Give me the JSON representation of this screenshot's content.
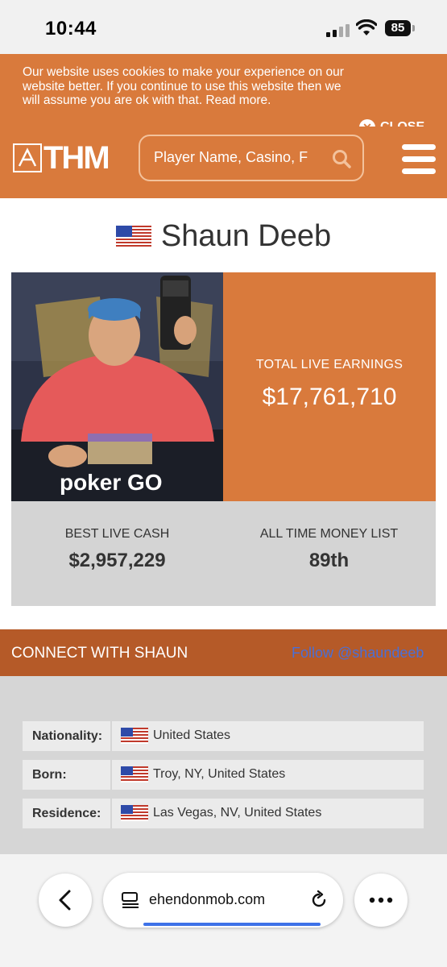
{
  "status_bar": {
    "time": "10:44",
    "battery": "85"
  },
  "cookie_banner": {
    "text": "Our website uses cookies to make your experience on our website better. If you continue to use this website then we will assume you are ok with that. Read more.",
    "close_label": "CLOSE"
  },
  "header": {
    "logo_text": "THM",
    "search_placeholder": "Player Name, Casino, F"
  },
  "player": {
    "name": "Shaun Deeb",
    "photo_watermark": "poker GO",
    "total_live_earnings_label": "TOTAL LIVE EARNINGS",
    "total_live_earnings_value": "$17,761,710",
    "best_live_cash_label": "BEST LIVE CASH",
    "best_live_cash_value": "$2,957,229",
    "all_time_money_list_label": "ALL TIME MONEY LIST",
    "all_time_money_list_value": "89th"
  },
  "connect": {
    "label": "CONNECT WITH SHAUN",
    "follow_link": "Follow @shaundeeb"
  },
  "info": [
    {
      "label": "Nationality:",
      "value": "United States"
    },
    {
      "label": "Born:",
      "value": "Troy, NY, United States"
    },
    {
      "label": "Residence:",
      "value": "Las Vegas, NV, United States"
    }
  ],
  "browser": {
    "url": "ehendonmob.com"
  },
  "colors": {
    "brand_orange": "#d97a3c",
    "connect_bar": "#b55a28",
    "link_blue": "#4a6fd6"
  }
}
